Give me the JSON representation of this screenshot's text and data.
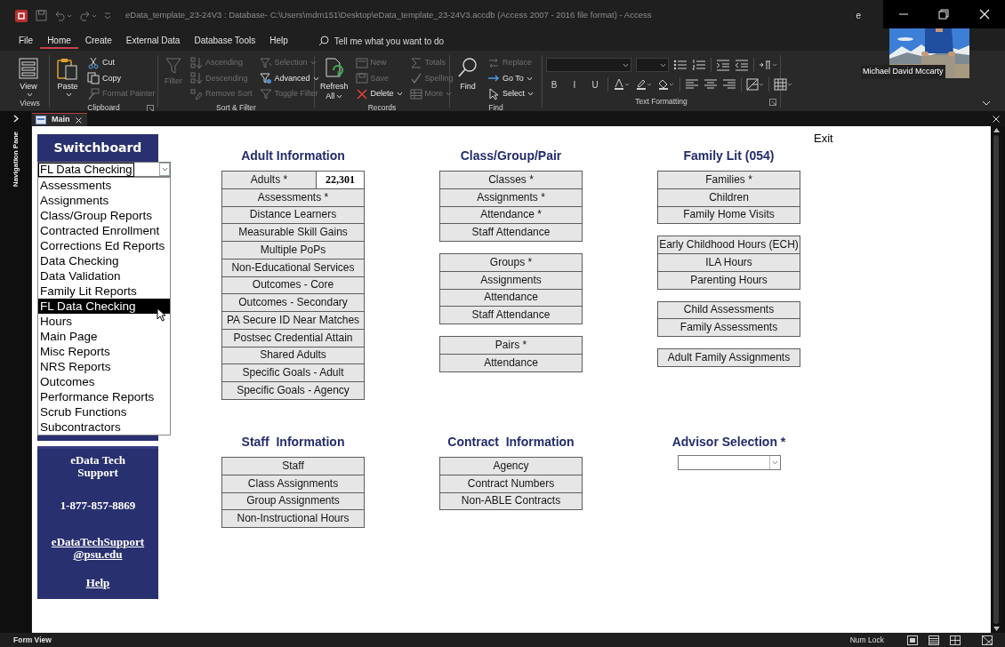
{
  "title_bar": {
    "title": "eData_template_23-24V3 : Database- C:\\Users\\mdm151\\Desktop\\eData_template_23-24V3.accdb (Access 2007 - 2016 file format)  -  Access",
    "partial_text": "e"
  },
  "video_tile": {
    "name": "Michael David Mccarty"
  },
  "menu_tabs": [
    {
      "label": "File",
      "selected": false
    },
    {
      "label": "Home",
      "selected": true
    },
    {
      "label": "Create",
      "selected": false
    },
    {
      "label": "External Data",
      "selected": false
    },
    {
      "label": "Database Tools",
      "selected": false
    },
    {
      "label": "Help",
      "selected": false
    }
  ],
  "tell_me": {
    "placeholder": "Tell me what you want to do"
  },
  "ribbon": {
    "groups": [
      {
        "label": "Views",
        "kind": "commands",
        "launcher": false,
        "columns": [
          [
            {
              "label": "View",
              "kind": "large",
              "disabled": false,
              "dropdown": true
            }
          ]
        ]
      },
      {
        "label": "Clipboard",
        "kind": "commands",
        "launcher": true,
        "columns": [
          [
            {
              "label": "Paste",
              "kind": "large",
              "disabled": false,
              "dropdown": true
            }
          ],
          [
            {
              "label": "Cut",
              "kind": "small",
              "disabled": false,
              "dropdown": false
            },
            {
              "label": "Copy",
              "kind": "small",
              "disabled": false,
              "dropdown": false
            },
            {
              "label": "Format Painter",
              "kind": "small",
              "disabled": true,
              "dropdown": false
            }
          ]
        ]
      },
      {
        "label": "Sort & Filter",
        "kind": "commands",
        "launcher": false,
        "columns": [
          [
            {
              "label": "Filter",
              "kind": "large",
              "disabled": true,
              "dropdown": false
            }
          ],
          [
            {
              "label": "Ascending",
              "kind": "small",
              "disabled": true,
              "dropdown": false
            },
            {
              "label": "Descending",
              "kind": "small",
              "disabled": true,
              "dropdown": false
            },
            {
              "label": "Remove Sort",
              "kind": "small",
              "disabled": true,
              "dropdown": false
            }
          ],
          [
            {
              "label": "Selection",
              "kind": "small",
              "disabled": true,
              "dropdown": true
            },
            {
              "label": "Advanced",
              "kind": "small",
              "disabled": false,
              "dropdown": true
            },
            {
              "label": "Toggle Filter",
              "kind": "small",
              "disabled": true,
              "dropdown": false
            }
          ]
        ]
      },
      {
        "label": "Records",
        "kind": "commands",
        "launcher": false,
        "columns": [
          [
            {
              "label": "Refresh All",
              "kind": "large",
              "disabled": false,
              "dropdown": true
            }
          ],
          [
            {
              "label": "New",
              "kind": "small",
              "disabled": true,
              "dropdown": false
            },
            {
              "label": "Save",
              "kind": "small",
              "disabled": true,
              "dropdown": false
            },
            {
              "label": "Delete",
              "kind": "small",
              "disabled": false,
              "dropdown": true
            }
          ],
          [
            {
              "label": "Totals",
              "kind": "small",
              "disabled": true,
              "dropdown": false
            },
            {
              "label": "Spelling",
              "kind": "small",
              "disabled": true,
              "dropdown": false
            },
            {
              "label": "More",
              "kind": "small",
              "disabled": true,
              "dropdown": true
            }
          ]
        ]
      },
      {
        "label": "Find",
        "kind": "commands",
        "launcher": false,
        "columns": [
          [
            {
              "label": "Find",
              "kind": "large",
              "disabled": false,
              "dropdown": false
            }
          ],
          [
            {
              "label": "Replace",
              "kind": "small",
              "disabled": true,
              "dropdown": false
            },
            {
              "label": "Go To",
              "kind": "small",
              "disabled": false,
              "dropdown": true
            },
            {
              "label": "Select",
              "kind": "small",
              "disabled": false,
              "dropdown": true
            }
          ]
        ]
      },
      {
        "label": "Text Formatting",
        "kind": "formatting",
        "launcher": true,
        "format_buttons": [
          "B",
          "I",
          "U"
        ]
      }
    ]
  },
  "document_tabs": [
    {
      "label": "Main",
      "selected": true
    }
  ],
  "navigation_pane": {
    "label": "Navigation Pane"
  },
  "switchboard": {
    "title": "Switchboard",
    "combo_value": "FL Data Checking",
    "options": [
      {
        "label": "Assessments",
        "selected": false
      },
      {
        "label": "Assignments",
        "selected": false
      },
      {
        "label": "Class/Group Reports",
        "selected": false
      },
      {
        "label": "Contracted Enrollment",
        "selected": false
      },
      {
        "label": "Corrections Ed Reports",
        "selected": false
      },
      {
        "label": "Data Checking",
        "selected": false
      },
      {
        "label": "Data Validation",
        "selected": false
      },
      {
        "label": "Family Lit Reports",
        "selected": false
      },
      {
        "label": "FL Data Checking",
        "selected": true
      },
      {
        "label": "Hours",
        "selected": false
      },
      {
        "label": "Main Page",
        "selected": false
      },
      {
        "label": "Misc Reports",
        "selected": false
      },
      {
        "label": "NRS Reports",
        "selected": false
      },
      {
        "label": "Outcomes",
        "selected": false
      },
      {
        "label": "Performance Reports",
        "selected": false
      },
      {
        "label": "Scrub Functions",
        "selected": false
      },
      {
        "label": "Subcontractors",
        "selected": false
      }
    ],
    "support": {
      "heading": "eData Tech\nSupport",
      "phone": "1-877-857-8869",
      "email": "eDataTechSupport\n@psu.edu",
      "help": "Help"
    }
  },
  "exit_label": "Exit",
  "sections": [
    {
      "title": "Adult Information",
      "kind": "buttons",
      "groups": [
        [
          {
            "label": "Adults *",
            "count": "22,301"
          },
          {
            "label": "Assessments *"
          },
          {
            "label": "Distance Learners"
          },
          {
            "label": "Measurable Skill Gains"
          },
          {
            "label": "Multiple PoPs"
          },
          {
            "label": "Non-Educational Services"
          },
          {
            "label": "Outcomes - Core"
          },
          {
            "label": "Outcomes - Secondary"
          },
          {
            "label": "PA Secure ID Near Matches"
          },
          {
            "label": "Postsec Credential Attain"
          },
          {
            "label": "Shared Adults"
          },
          {
            "label": "Specific Goals - Adult"
          },
          {
            "label": "Specific Goals - Agency"
          }
        ]
      ]
    },
    {
      "title": "Class/Group/Pair",
      "kind": "buttons",
      "groups": [
        [
          {
            "label": "Classes *"
          },
          {
            "label": "Assignments *"
          },
          {
            "label": "Attendance *"
          },
          {
            "label": "Staff Attendance"
          }
        ],
        [
          {
            "label": "Groups *"
          },
          {
            "label": "Assignments"
          },
          {
            "label": "Attendance"
          },
          {
            "label": "Staff Attendance"
          }
        ],
        [
          {
            "label": "Pairs *"
          },
          {
            "label": "Attendance"
          }
        ]
      ]
    },
    {
      "title": "Family Lit (054)",
      "kind": "buttons",
      "groups": [
        [
          {
            "label": "Families *"
          },
          {
            "label": "Children"
          },
          {
            "label": "Family Home Visits"
          }
        ],
        [
          {
            "label": "Early Childhood Hours (ECH)"
          },
          {
            "label": "ILA Hours"
          },
          {
            "label": "Parenting Hours"
          }
        ],
        [
          {
            "label": "Child Assessments"
          },
          {
            "label": "Family Assessments"
          }
        ],
        [
          {
            "label": "Adult Family Assignments"
          }
        ]
      ]
    },
    {
      "title": "Staff  Information",
      "kind": "buttons",
      "groups": [
        [
          {
            "label": "Staff"
          },
          {
            "label": "Class Assignments"
          },
          {
            "label": "Group Assignments"
          },
          {
            "label": "Non-Instructional Hours"
          }
        ]
      ]
    },
    {
      "title": "Contract  Information",
      "kind": "buttons",
      "groups": [
        [
          {
            "label": "Agency"
          },
          {
            "label": "Contract Numbers"
          },
          {
            "label": "Non-ABLE Contracts"
          }
        ]
      ]
    },
    {
      "title": "Advisor Selection *",
      "kind": "combo"
    }
  ],
  "status_bar": {
    "mode": "Form View",
    "indicator": "Num Lock"
  }
}
